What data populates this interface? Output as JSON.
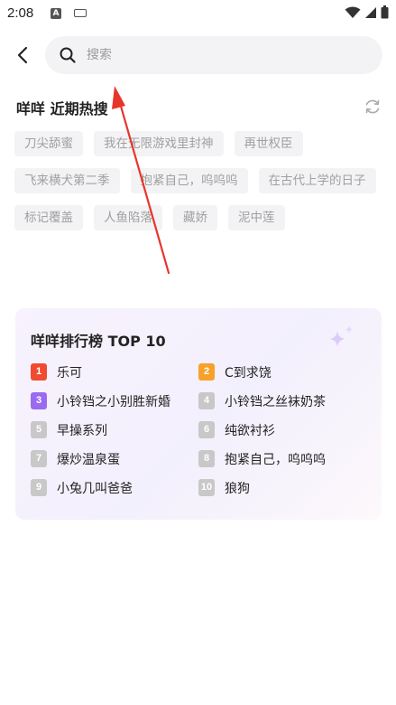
{
  "status_bar": {
    "time": "2:08",
    "a_label": "A",
    "icons": [
      "notification-a-icon",
      "keyboard-icon",
      "wifi-icon",
      "signal-icon",
      "battery-icon"
    ]
  },
  "header": {
    "search_placeholder": "搜索"
  },
  "recent": {
    "title": "咩咩 近期热搜",
    "tags": [
      "刀尖舔蜜",
      "我在无限游戏里封神",
      "再世权臣",
      "飞来横犬第二季",
      "抱紧自己，呜呜呜",
      "在古代上学的日子",
      "标记覆盖",
      "人鱼陷落",
      "藏娇",
      "泥中莲"
    ]
  },
  "ranking": {
    "title": "咩咩排行榜 TOP 10",
    "items": [
      {
        "num": "1",
        "name": "乐可",
        "color": "#f04b31"
      },
      {
        "num": "2",
        "name": "C到求饶",
        "color": "#f7a12c"
      },
      {
        "num": "3",
        "name": "小铃铛之小别胜新婚",
        "color": "#9a6bf2"
      },
      {
        "num": "4",
        "name": "小铃铛之丝袜奶茶",
        "color": "#c8c8c8"
      },
      {
        "num": "5",
        "name": "早操系列",
        "color": "#c8c8c8"
      },
      {
        "num": "6",
        "name": "纯欲衬衫",
        "color": "#c8c8c8"
      },
      {
        "num": "7",
        "name": "爆炒温泉蛋",
        "color": "#c8c8c8"
      },
      {
        "num": "8",
        "name": "抱紧自己，呜呜呜",
        "color": "#c8c8c8"
      },
      {
        "num": "9",
        "name": "小兔几叫爸爸",
        "color": "#c8c8c8"
      },
      {
        "num": "10",
        "name": "狼狗",
        "color": "#c8c8c8"
      }
    ]
  },
  "colors": {
    "accent_red": "#e8352b",
    "tag_bg": "#f3f3f5",
    "tag_text": "#a0a0a0"
  }
}
